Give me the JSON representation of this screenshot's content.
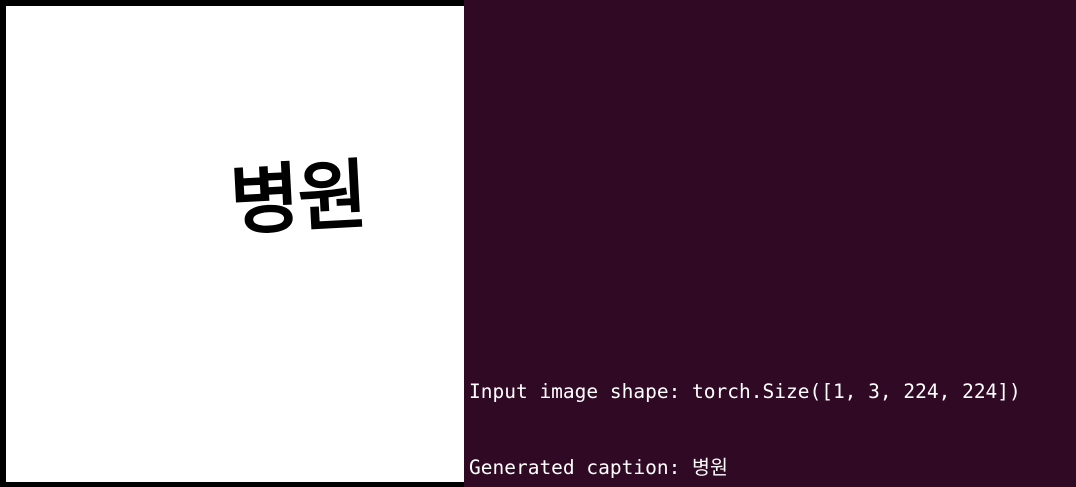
{
  "image_panel": {
    "handwritten_text": "병원"
  },
  "terminal": {
    "background_color": "#300a24",
    "text_color": "#ffffff",
    "lines": [
      "Input image shape: torch.Size([1, 3, 224, 224])",
      "Generated caption: 병원"
    ]
  }
}
